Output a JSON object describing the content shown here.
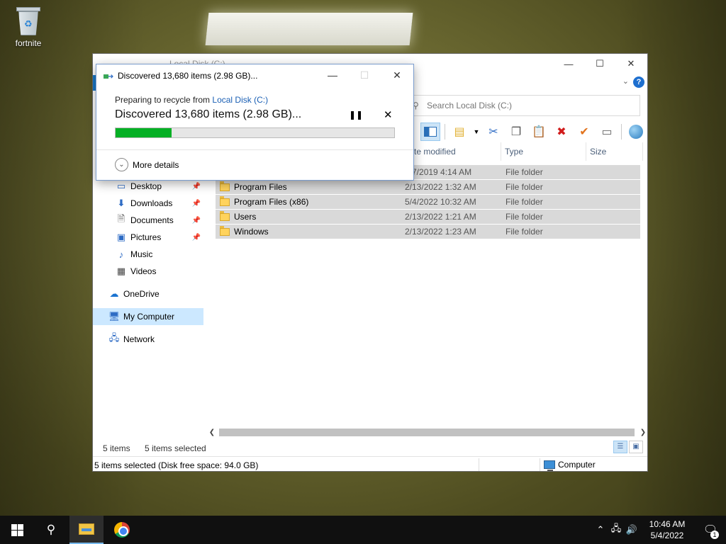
{
  "desktop": {
    "icon_label": "fortnite"
  },
  "explorer": {
    "title": "Local Disk (C:)",
    "search_placeholder": "Search Local Disk (C:)",
    "columns": {
      "date_modified": "te modified",
      "type": "Type",
      "size": "Size"
    },
    "nav": [
      {
        "label": "Desktop",
        "icon": "desktop-icon",
        "pinned": true
      },
      {
        "label": "Downloads",
        "icon": "downloads-icon",
        "pinned": true
      },
      {
        "label": "Documents",
        "icon": "documents-icon",
        "pinned": true
      },
      {
        "label": "Pictures",
        "icon": "pictures-icon",
        "pinned": true
      },
      {
        "label": "Music",
        "icon": "music-icon",
        "pinned": false
      },
      {
        "label": "Videos",
        "icon": "videos-icon",
        "pinned": false
      }
    ],
    "nav_onedrive": "OneDrive",
    "nav_mycomputer": "My Computer",
    "nav_network": "Network",
    "files": [
      {
        "name": "",
        "date": "7/7/2019 4:14 AM",
        "type": "File folder"
      },
      {
        "name": "Program Files",
        "date": "2/13/2022 1:32 AM",
        "type": "File folder"
      },
      {
        "name": "Program Files (x86)",
        "date": "5/4/2022 10:32 AM",
        "type": "File folder"
      },
      {
        "name": "Users",
        "date": "2/13/2022 1:21 AM",
        "type": "File folder"
      },
      {
        "name": "Windows",
        "date": "2/13/2022 1:23 AM",
        "type": "File folder"
      }
    ],
    "status_items": "5 items",
    "status_selected": "5 items selected",
    "status_bar_left": "5 items selected (Disk free space: 94.0 GB)",
    "status_bar_right": "Computer"
  },
  "dialog": {
    "title": "Discovered 13,680 items (2.98 GB)...",
    "preparing_prefix": "Preparing to recycle from ",
    "preparing_link": "Local Disk (C:)",
    "big_text": "Discovered 13,680 items (2.98 GB)...",
    "progress_fraction": 0.2,
    "more_details": "More details"
  },
  "taskbar": {
    "time": "10:46 AM",
    "date": "5/4/2022",
    "notification_count": "1"
  },
  "colors": {
    "accent": "#1979ca",
    "progress": "#06b025",
    "link": "#1a5fb4"
  }
}
